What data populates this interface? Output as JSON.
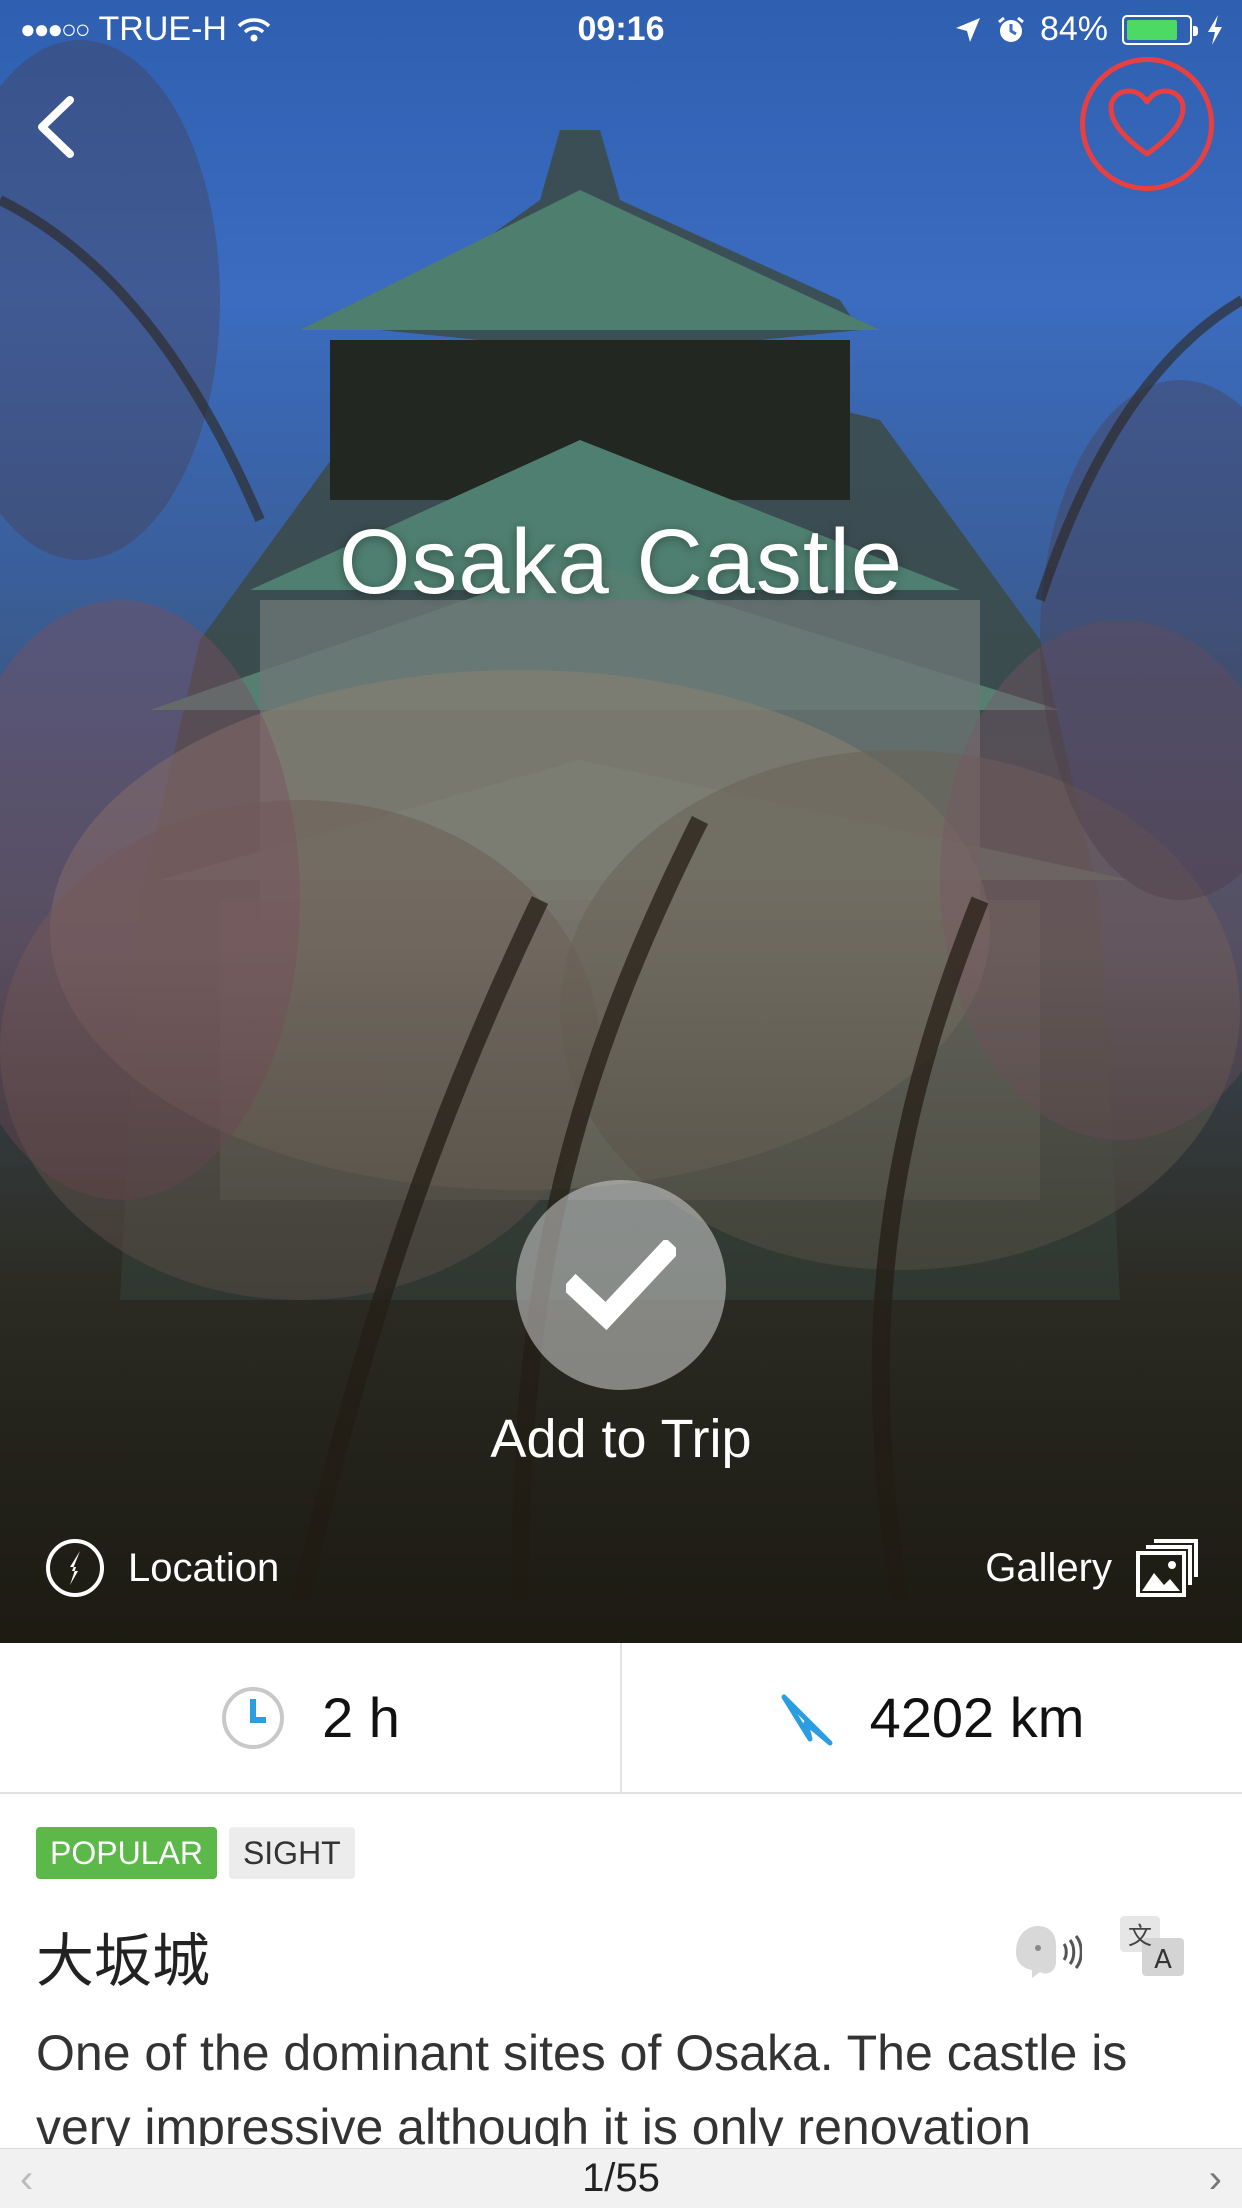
{
  "status_bar": {
    "signal": "●●●○○",
    "carrier": "TRUE-H",
    "time": "09:16",
    "battery": "84%",
    "battery_level": 0.84
  },
  "place": {
    "title": "Osaka Castle",
    "native_name": "大坂城",
    "description": "One of the dominant sites of Osaka. The castle is very impressive although it is only renovation"
  },
  "actions": {
    "add_to_trip": "Add to Trip",
    "location": "Location",
    "gallery": "Gallery"
  },
  "stats": {
    "duration": "2 h",
    "distance": "4202 km"
  },
  "tags": [
    "POPULAR",
    "SIGHT"
  ],
  "pager": {
    "position": "1/55",
    "prev": "‹",
    "next": "›"
  },
  "colors": {
    "favorite": "#e84040",
    "popular_tag": "#5cb848",
    "accent_blue": "#2a9ee0",
    "battery": "#4cd964"
  },
  "icons": [
    "back-chevron-icon",
    "heart-icon",
    "checkmark-icon",
    "compass-icon",
    "gallery-icon",
    "clock-icon",
    "navigation-arrow-icon",
    "speaker-icon",
    "translate-icon",
    "wifi-icon",
    "location-arrow-icon",
    "alarm-icon",
    "charging-icon"
  ]
}
